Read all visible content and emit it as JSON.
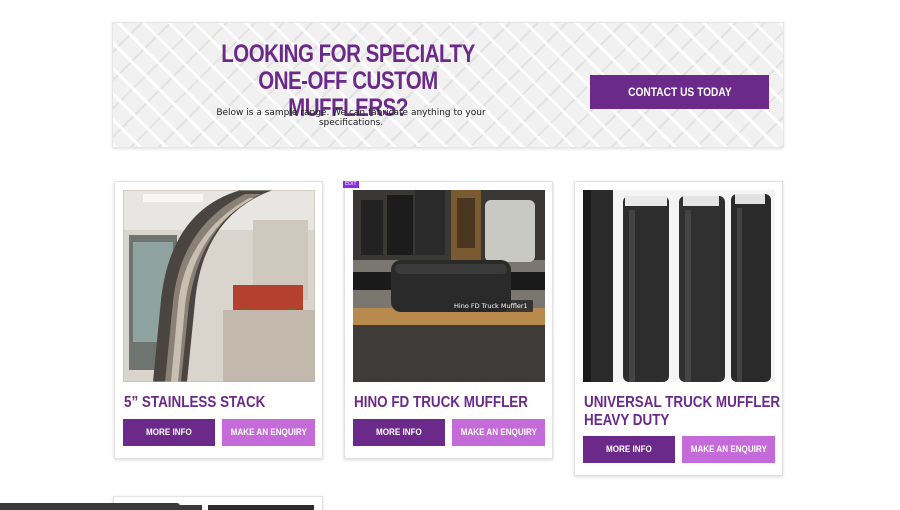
{
  "hero": {
    "title": "LOOKING FOR SPECIALTY ONE-OFF CUSTOM MUFFLERS?",
    "subtitle": "Below is a sample range. We can fabricate anything to your specifications.",
    "cta_label": "CONTACT US TODAY"
  },
  "products": [
    {
      "title": "5” STAINLESS STACK",
      "more_info_label": "MORE INFO",
      "enquiry_label": "MAKE AN ENQUIRY"
    },
    {
      "title": "HINO FD TRUCK MUFFLER",
      "more_info_label": "MORE INFO",
      "enquiry_label": "MAKE AN ENQUIRY",
      "edit_tag": "EDIT",
      "image_tooltip": "Hino FD Truck Muffler1"
    },
    {
      "title_line1": "UNIVERSAL TRUCK MUFFLER",
      "title_line2": "HEAVY DUTY",
      "more_info_label": "MORE INFO",
      "enquiry_label": "MAKE AN ENQUIRY"
    }
  ],
  "colors": {
    "brand_purple": "#6b2a8a",
    "light_purple": "#c56bd9",
    "edit_tag": "#8a2be2"
  }
}
